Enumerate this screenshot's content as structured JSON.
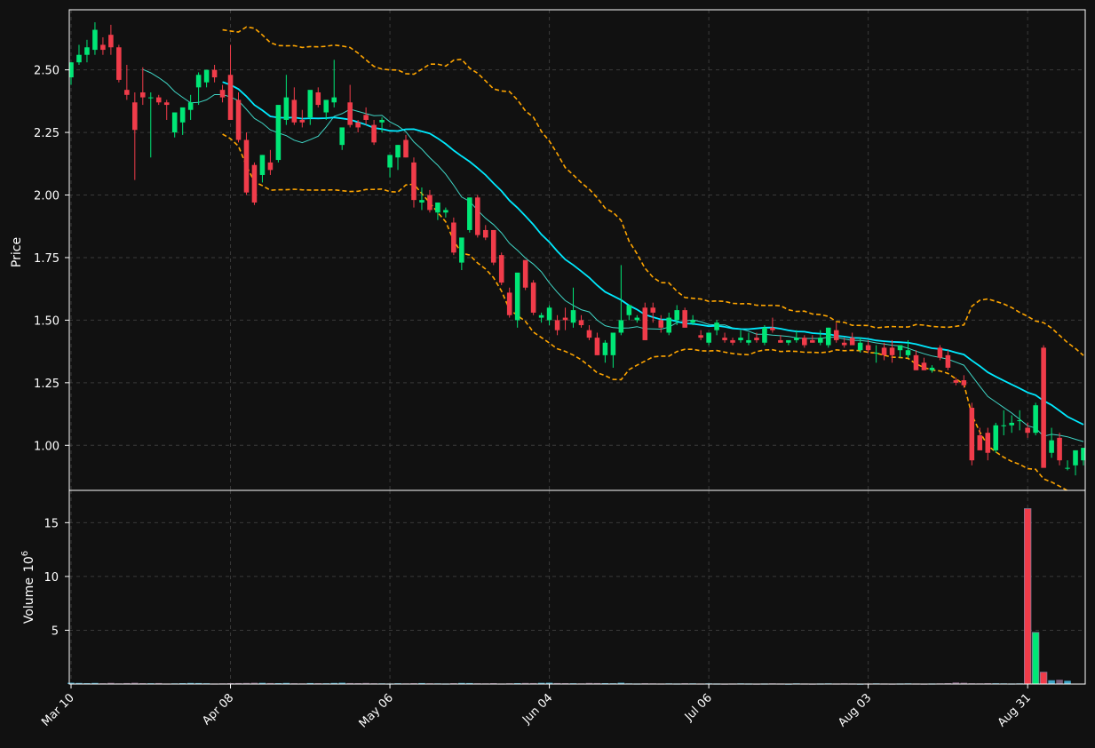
{
  "chart_data": {
    "type": "candlestick",
    "title": "",
    "y_label": "Price",
    "volume_label": "Volume",
    "volume_exponent": "10",
    "volume_exponent_power": "6",
    "y_ticks": [
      "1.00",
      "1.25",
      "1.50",
      "1.75",
      "2.00",
      "2.25",
      "2.50"
    ],
    "volume_ticks": [
      "5",
      "10",
      "15"
    ],
    "x_tick_labels": [
      "Mar 10",
      "Apr 08",
      "May 06",
      "Jun 04",
      "Jul 06",
      "Aug 03",
      "Aug 31"
    ],
    "x_tick_indices": [
      0,
      20,
      40,
      60,
      80,
      100,
      120
    ],
    "y_range": [
      0.82,
      2.74
    ],
    "volume_range": [
      0,
      18
    ],
    "grid": true,
    "colors": {
      "background": "#111111",
      "up": "#00e676",
      "down": "#f03c4a",
      "ma_slow": "#00eaff",
      "ma_fast": "#3fd5c5",
      "bollinger": "#ffa500",
      "grid": "#3a3a3a",
      "text": "#ffffff"
    },
    "ohlc": [
      [
        2.47,
        2.53,
        2.44,
        2.53
      ],
      [
        2.53,
        2.6,
        2.52,
        2.56
      ],
      [
        2.56,
        2.62,
        2.53,
        2.59
      ],
      [
        2.58,
        2.69,
        2.56,
        2.66
      ],
      [
        2.6,
        2.63,
        2.56,
        2.58
      ],
      [
        2.64,
        2.68,
        2.56,
        2.59
      ],
      [
        2.59,
        2.6,
        2.45,
        2.46
      ],
      [
        2.42,
        2.52,
        2.38,
        2.4
      ],
      [
        2.37,
        2.41,
        2.06,
        2.26
      ],
      [
        2.41,
        2.51,
        2.36,
        2.39
      ],
      [
        2.39,
        2.41,
        2.15,
        2.39
      ],
      [
        2.39,
        2.4,
        2.36,
        2.37
      ],
      [
        2.37,
        2.38,
        2.3,
        2.36
      ],
      [
        2.25,
        2.32,
        2.23,
        2.33
      ],
      [
        2.29,
        2.31,
        2.24,
        2.35
      ],
      [
        2.34,
        2.4,
        2.3,
        2.37
      ],
      [
        2.43,
        2.49,
        2.36,
        2.48
      ],
      [
        2.45,
        2.5,
        2.43,
        2.5
      ],
      [
        2.5,
        2.52,
        2.45,
        2.47
      ],
      [
        2.42,
        2.44,
        2.37,
        2.39
      ],
      [
        2.48,
        2.6,
        2.35,
        2.3
      ],
      [
        2.38,
        2.41,
        2.21,
        2.22
      ],
      [
        2.22,
        2.25,
        2.0,
        2.01
      ],
      [
        2.12,
        2.13,
        1.96,
        1.97
      ],
      [
        2.08,
        2.16,
        2.05,
        2.16
      ],
      [
        2.13,
        2.18,
        2.08,
        2.1
      ],
      [
        2.14,
        2.32,
        2.13,
        2.36
      ],
      [
        2.3,
        2.48,
        2.28,
        2.39
      ],
      [
        2.38,
        2.43,
        2.28,
        2.29
      ],
      [
        2.3,
        2.34,
        2.27,
        2.29
      ],
      [
        2.31,
        2.36,
        2.28,
        2.42
      ],
      [
        2.41,
        2.43,
        2.35,
        2.36
      ],
      [
        2.33,
        2.38,
        2.3,
        2.38
      ],
      [
        2.37,
        2.54,
        2.35,
        2.39
      ],
      [
        2.2,
        2.26,
        2.18,
        2.27
      ],
      [
        2.37,
        2.44,
        2.27,
        2.28
      ],
      [
        2.29,
        2.3,
        2.25,
        2.27
      ],
      [
        2.32,
        2.35,
        2.28,
        2.3
      ],
      [
        2.28,
        2.3,
        2.2,
        2.21
      ],
      [
        2.29,
        2.31,
        2.25,
        2.3
      ],
      [
        2.11,
        2.16,
        2.07,
        2.16
      ],
      [
        2.15,
        2.2,
        2.1,
        2.2
      ],
      [
        2.22,
        2.24,
        2.15,
        2.15
      ],
      [
        2.13,
        2.15,
        1.95,
        1.98
      ],
      [
        1.97,
        2.03,
        1.94,
        1.98
      ],
      [
        2.0,
        2.02,
        1.93,
        1.94
      ],
      [
        1.93,
        1.97,
        1.9,
        1.97
      ],
      [
        1.93,
        1.95,
        1.91,
        1.94
      ],
      [
        1.89,
        1.91,
        1.76,
        1.77
      ],
      [
        1.73,
        1.79,
        1.7,
        1.83
      ],
      [
        1.86,
        1.99,
        1.85,
        1.99
      ],
      [
        1.99,
        2.0,
        1.83,
        1.84
      ],
      [
        1.86,
        1.88,
        1.82,
        1.83
      ],
      [
        1.86,
        1.86,
        1.72,
        1.73
      ],
      [
        1.76,
        1.77,
        1.64,
        1.65
      ],
      [
        1.61,
        1.63,
        1.51,
        1.52
      ],
      [
        1.5,
        1.59,
        1.47,
        1.69
      ],
      [
        1.74,
        1.74,
        1.62,
        1.63
      ],
      [
        1.65,
        1.66,
        1.52,
        1.53
      ],
      [
        1.51,
        1.53,
        1.49,
        1.52
      ],
      [
        1.5,
        1.56,
        1.48,
        1.55
      ],
      [
        1.5,
        1.52,
        1.44,
        1.46
      ],
      [
        1.51,
        1.55,
        1.46,
        1.5
      ],
      [
        1.49,
        1.63,
        1.47,
        1.54
      ],
      [
        1.5,
        1.52,
        1.47,
        1.48
      ],
      [
        1.46,
        1.48,
        1.42,
        1.43
      ],
      [
        1.43,
        1.45,
        1.36,
        1.36
      ],
      [
        1.36,
        1.42,
        1.33,
        1.41
      ],
      [
        1.36,
        1.45,
        1.31,
        1.45
      ],
      [
        1.45,
        1.72,
        1.44,
        1.5
      ],
      [
        1.52,
        1.56,
        1.5,
        1.56
      ],
      [
        1.5,
        1.52,
        1.49,
        1.51
      ],
      [
        1.55,
        1.57,
        1.42,
        1.42
      ],
      [
        1.55,
        1.57,
        1.49,
        1.53
      ],
      [
        1.5,
        1.52,
        1.45,
        1.47
      ],
      [
        1.45,
        1.53,
        1.44,
        1.51
      ],
      [
        1.5,
        1.56,
        1.48,
        1.54
      ],
      [
        1.54,
        1.55,
        1.47,
        1.47
      ],
      [
        1.49,
        1.52,
        1.48,
        1.5
      ],
      [
        1.44,
        1.46,
        1.42,
        1.43
      ],
      [
        1.41,
        1.44,
        1.4,
        1.45
      ],
      [
        1.46,
        1.5,
        1.44,
        1.49
      ],
      [
        1.43,
        1.45,
        1.41,
        1.42
      ],
      [
        1.42,
        1.43,
        1.4,
        1.41
      ],
      [
        1.42,
        1.46,
        1.41,
        1.43
      ],
      [
        1.41,
        1.45,
        1.4,
        1.42
      ],
      [
        1.43,
        1.45,
        1.41,
        1.42
      ],
      [
        1.41,
        1.48,
        1.4,
        1.47
      ],
      [
        1.47,
        1.51,
        1.45,
        1.46
      ],
      [
        1.42,
        1.44,
        1.41,
        1.41
      ],
      [
        1.41,
        1.42,
        1.4,
        1.42
      ],
      [
        1.42,
        1.46,
        1.41,
        1.43
      ],
      [
        1.43,
        1.44,
        1.39,
        1.4
      ],
      [
        1.42,
        1.44,
        1.41,
        1.41
      ],
      [
        1.41,
        1.46,
        1.4,
        1.43
      ],
      [
        1.4,
        1.47,
        1.39,
        1.47
      ],
      [
        1.46,
        1.49,
        1.41,
        1.42
      ],
      [
        1.41,
        1.43,
        1.39,
        1.4
      ],
      [
        1.43,
        1.45,
        1.41,
        1.4
      ],
      [
        1.38,
        1.43,
        1.37,
        1.41
      ],
      [
        1.4,
        1.42,
        1.37,
        1.38
      ],
      [
        1.37,
        1.4,
        1.33,
        1.37
      ],
      [
        1.39,
        1.41,
        1.34,
        1.36
      ],
      [
        1.39,
        1.42,
        1.33,
        1.36
      ],
      [
        1.38,
        1.39,
        1.35,
        1.4
      ],
      [
        1.36,
        1.42,
        1.35,
        1.38
      ],
      [
        1.36,
        1.38,
        1.3,
        1.3
      ],
      [
        1.33,
        1.35,
        1.3,
        1.3
      ],
      [
        1.3,
        1.32,
        1.29,
        1.31
      ],
      [
        1.39,
        1.4,
        1.34,
        1.35
      ],
      [
        1.36,
        1.38,
        1.3,
        1.31
      ],
      [
        1.26,
        1.27,
        1.24,
        1.25
      ],
      [
        1.26,
        1.28,
        1.23,
        1.24
      ],
      [
        1.15,
        1.17,
        0.92,
        0.94
      ],
      [
        1.04,
        1.07,
        0.99,
        0.98
      ],
      [
        1.05,
        1.07,
        0.94,
        0.97
      ],
      [
        0.98,
        1.09,
        0.97,
        1.08
      ],
      [
        1.08,
        1.14,
        1.04,
        1.08
      ],
      [
        1.08,
        1.12,
        1.05,
        1.09
      ],
      [
        1.1,
        1.14,
        1.06,
        1.1
      ],
      [
        1.07,
        1.09,
        1.03,
        1.05
      ],
      [
        1.05,
        1.17,
        1.04,
        1.16
      ],
      [
        1.39,
        1.4,
        0.92,
        0.91
      ],
      [
        0.97,
        1.07,
        0.95,
        1.02
      ],
      [
        1.03,
        1.05,
        0.92,
        0.94
      ],
      [
        0.91,
        0.94,
        0.9,
        0.91
      ],
      [
        0.92,
        0.98,
        0.88,
        0.98
      ],
      [
        0.94,
        0.99,
        0.92,
        0.99
      ]
    ],
    "volume_millions": [
      0.12,
      0.1,
      0.08,
      0.1,
      0.07,
      0.11,
      0.06,
      0.09,
      0.12,
      0.08,
      0.07,
      0.09,
      0.05,
      0.06,
      0.08,
      0.1,
      0.09,
      0.07,
      0.05,
      0.06,
      0.08,
      0.09,
      0.1,
      0.12,
      0.11,
      0.09,
      0.08,
      0.1,
      0.07,
      0.06,
      0.09,
      0.08,
      0.07,
      0.1,
      0.12,
      0.09,
      0.08,
      0.1,
      0.07,
      0.06,
      0.05,
      0.07,
      0.06,
      0.08,
      0.09,
      0.07,
      0.06,
      0.05,
      0.08,
      0.1,
      0.09,
      0.07,
      0.06,
      0.08,
      0.05,
      0.07,
      0.08,
      0.1,
      0.09,
      0.11,
      0.12,
      0.09,
      0.08,
      0.07,
      0.06,
      0.1,
      0.09,
      0.08,
      0.07,
      0.12,
      0.06,
      0.05,
      0.07,
      0.06,
      0.05,
      0.06,
      0.05,
      0.07,
      0.06,
      0.05,
      0.06,
      0.05,
      0.04,
      0.05,
      0.06,
      0.05,
      0.04,
      0.05,
      0.06,
      0.05,
      0.04,
      0.06,
      0.05,
      0.04,
      0.05,
      0.06,
      0.05,
      0.06,
      0.05,
      0.04,
      0.05,
      0.06,
      0.05,
      0.04,
      0.05,
      0.06,
      0.05,
      0.04,
      0.05,
      0.06,
      0.08,
      0.15,
      0.12,
      0.07,
      0.06,
      0.08,
      0.07,
      0.06,
      0.05,
      0.06,
      16.3,
      4.8,
      1.1,
      0.35,
      0.4,
      0.3
    ],
    "ma_slow_window": 20,
    "ma_fast_window": 10,
    "bollinger_window": 20,
    "bollinger_std": 2
  }
}
